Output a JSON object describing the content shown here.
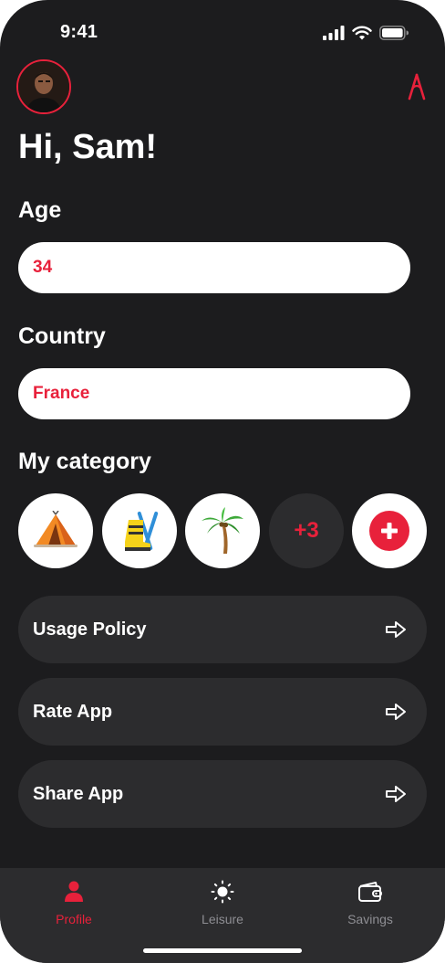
{
  "status_bar": {
    "time": "9:41"
  },
  "header": {
    "greeting": "Hi, Sam!"
  },
  "age": {
    "label": "Age",
    "value": "34"
  },
  "country": {
    "label": "Country",
    "value": "France"
  },
  "category": {
    "label": "My category",
    "items": [
      {
        "icon": "tent-icon"
      },
      {
        "icon": "ski-boot-icon"
      },
      {
        "icon": "palm-tree-icon"
      }
    ],
    "more_count": "+3",
    "add_icon": "add-icon"
  },
  "menu": [
    {
      "label": "Usage Policy",
      "icon": "arrow-right-icon"
    },
    {
      "label": "Rate App",
      "icon": "arrow-right-icon"
    },
    {
      "label": "Share App",
      "icon": "arrow-right-icon"
    }
  ],
  "tabbar": {
    "tabs": [
      {
        "label": "Profile",
        "icon": "person-icon",
        "active": true
      },
      {
        "label": "Leisure",
        "icon": "sun-icon",
        "active": false
      },
      {
        "label": "Savings",
        "icon": "wallet-icon",
        "active": false
      }
    ]
  },
  "colors": {
    "accent": "#e8213b",
    "background": "#1c1c1e",
    "surface": "#2c2c2e"
  }
}
